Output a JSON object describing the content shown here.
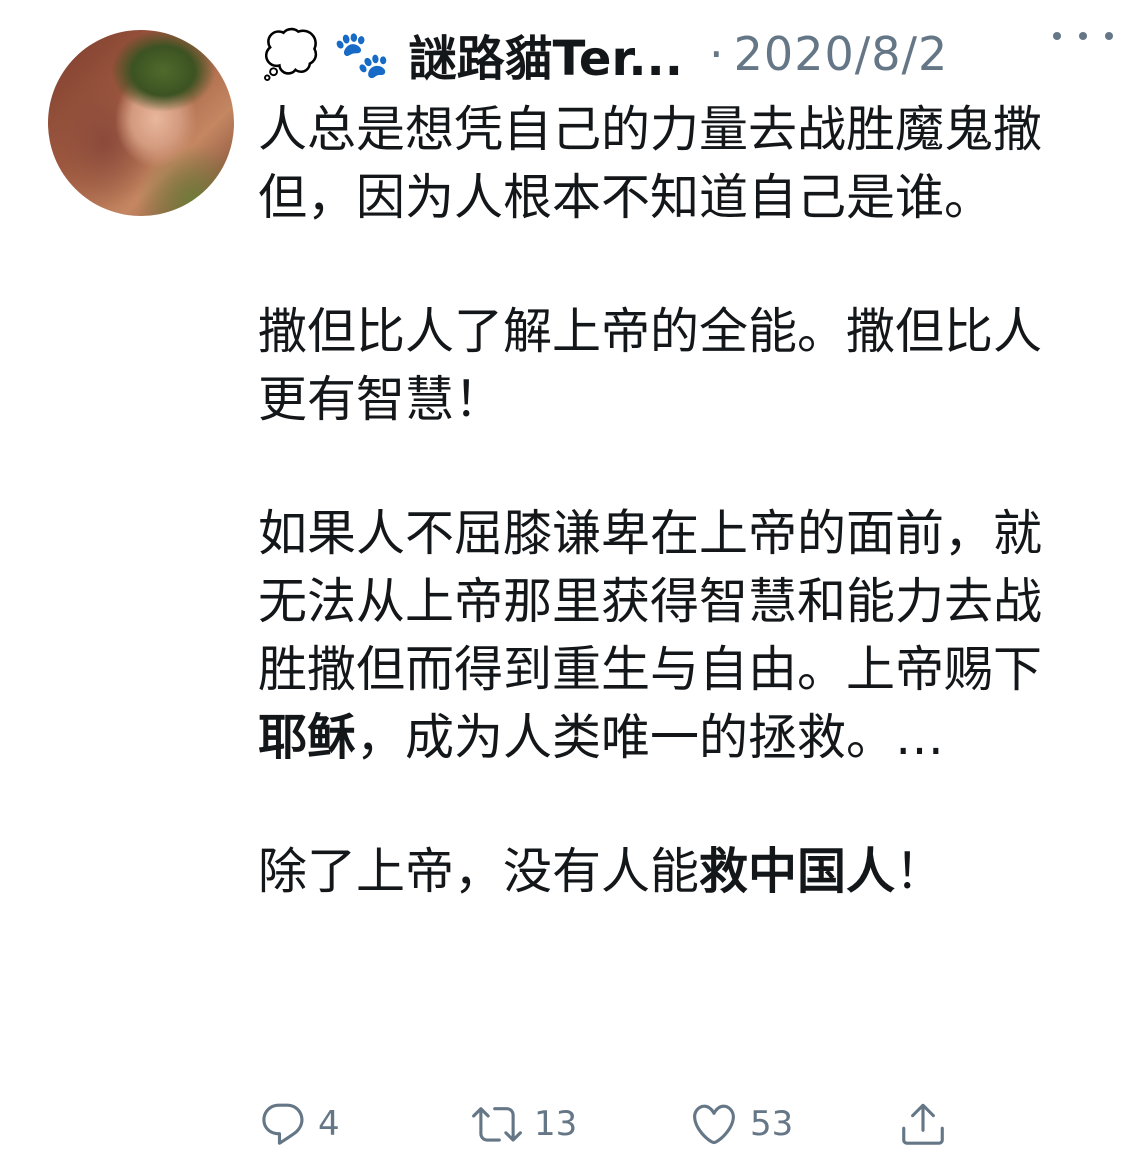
{
  "user": {
    "display_name": "謎路貓Ter...",
    "emojis": [
      "💭",
      "🐾"
    ],
    "separator": "·",
    "date": "2020/8/2"
  },
  "tweet": {
    "p1": "人总是想凭自己的力量去战胜魔鬼撒但，因为人根本不知道自己是谁。",
    "p2": "撒但比人了解上帝的全能。撒但比人更有智慧！",
    "p3": {
      "a": "如果人不屈膝谦卑在上帝的面前，就无法从上帝那里获得智慧和能力去战胜撒但而得到重生与自由。上帝赐下",
      "b": "耶稣",
      "c": "，成为人类唯一的拯救。…"
    },
    "p4": {
      "a": "除了上帝，没有人能",
      "b": "救中国人",
      "c": "！"
    }
  },
  "actions": {
    "reply_count": "4",
    "retweet_count": "13",
    "like_count": "53"
  },
  "icons": [
    "more-icon",
    "reply-icon",
    "retweet-icon",
    "like-icon",
    "share-icon"
  ],
  "colors": {
    "text": "#14171a",
    "muted": "#657786",
    "background": "#ffffff"
  }
}
